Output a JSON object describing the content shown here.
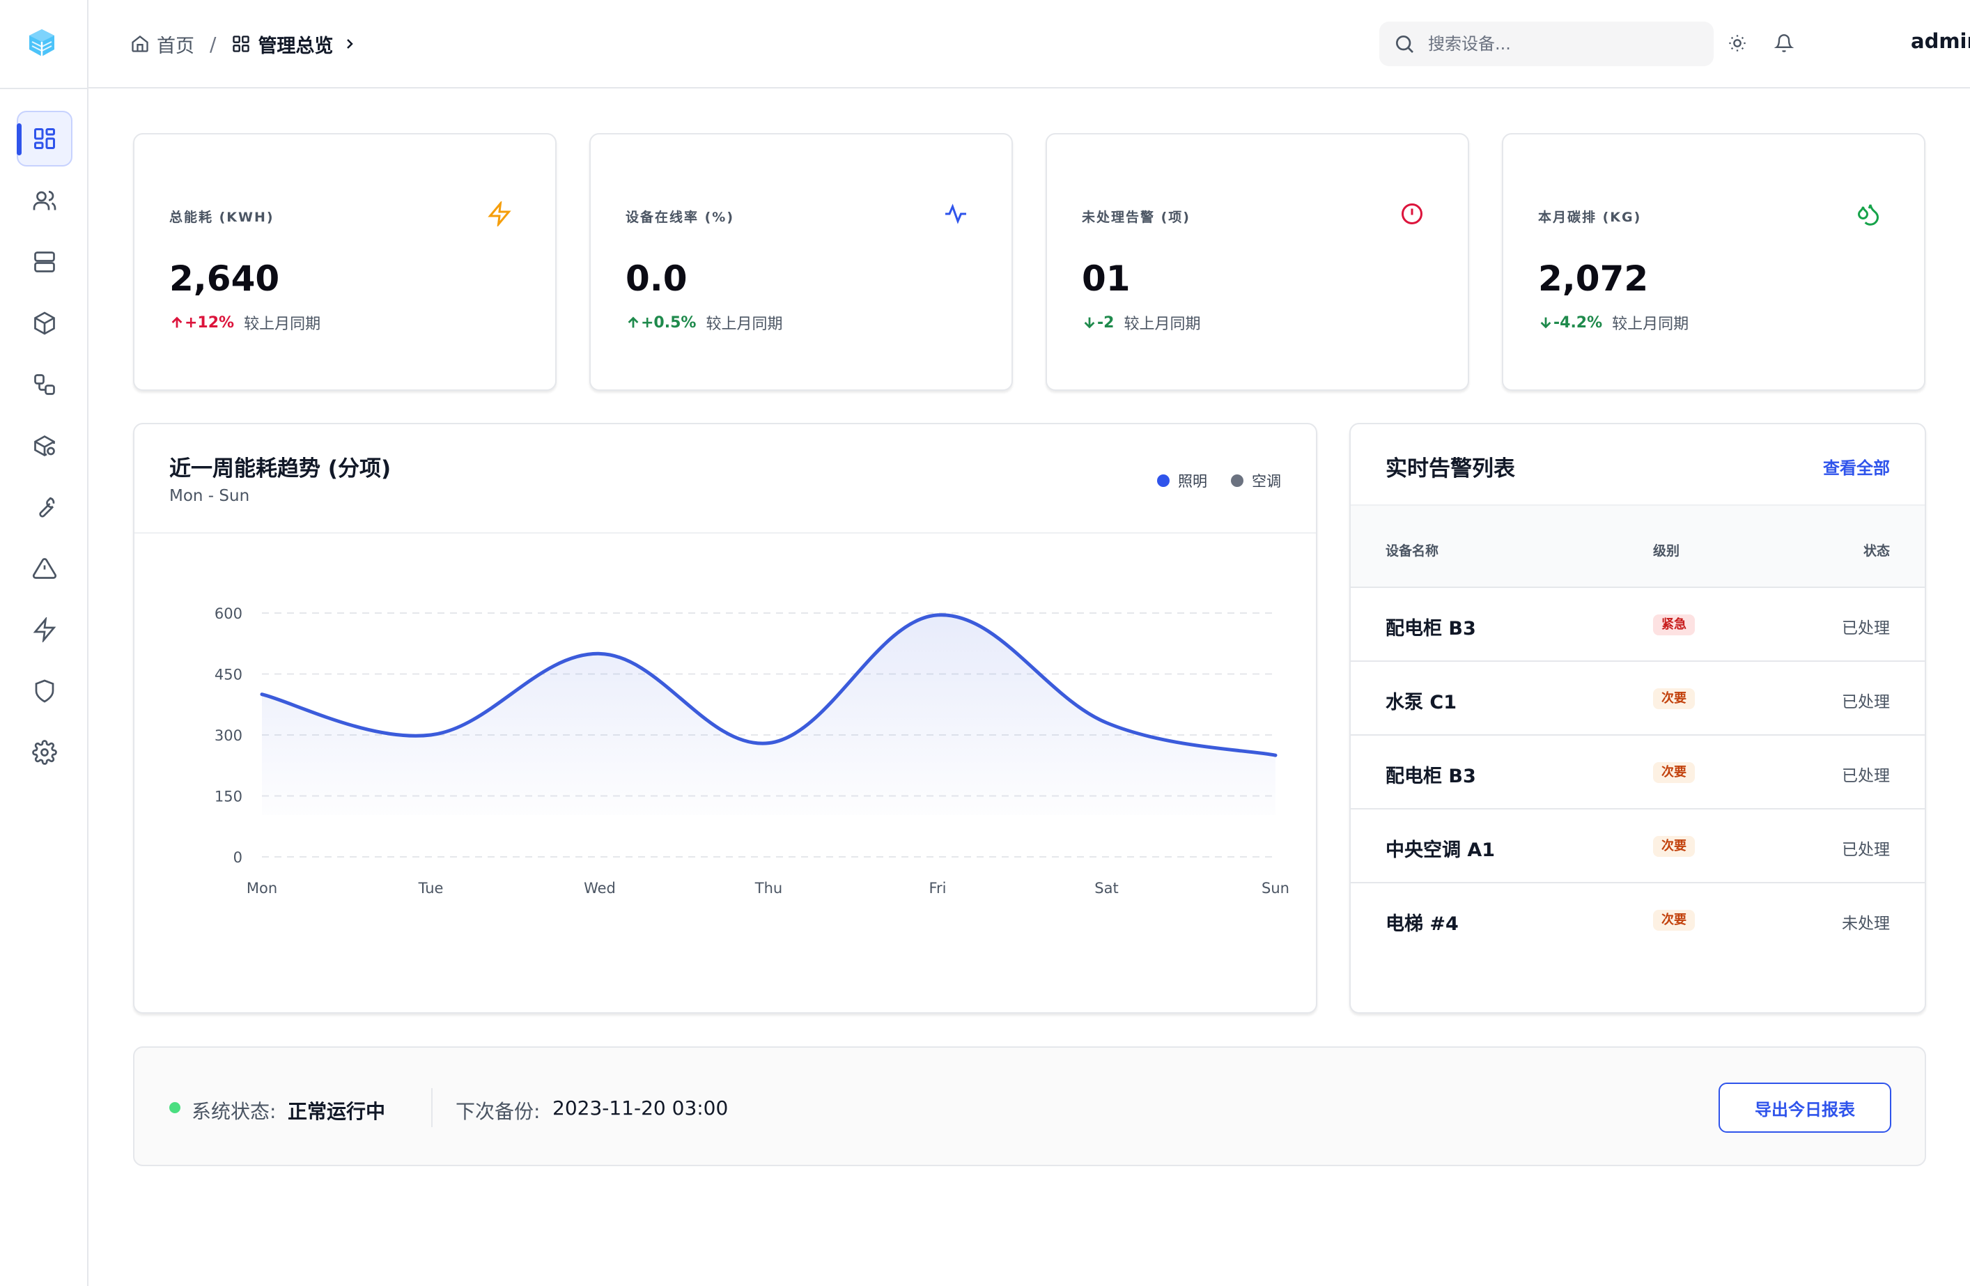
{
  "breadcrumb": {
    "home": "首页",
    "separator": "/",
    "current": "管理总览"
  },
  "search": {
    "placeholder": "搜索设备..."
  },
  "header": {
    "user": "admin"
  },
  "sidebar": {
    "items": [
      {
        "icon": "dashboard-icon",
        "active": true
      },
      {
        "icon": "users-icon"
      },
      {
        "icon": "server-icon"
      },
      {
        "icon": "box-icon"
      },
      {
        "icon": "workflow-icon"
      },
      {
        "icon": "package-settings-icon"
      },
      {
        "icon": "wrench-icon"
      },
      {
        "icon": "warning-icon"
      },
      {
        "icon": "lightning-icon"
      },
      {
        "icon": "shield-icon"
      },
      {
        "icon": "gear-icon"
      }
    ]
  },
  "kpis": [
    {
      "label": "总能耗 (KWH)",
      "value": "2,640",
      "delta": "+12%",
      "note": "较上月同期",
      "icon": "lightning-icon",
      "color": "#f59e0b",
      "delta_color": "#dc143c",
      "direction": "up"
    },
    {
      "label": "设备在线率 (%)",
      "value": "0.0",
      "delta": "+0.5%",
      "note": "较上月同期",
      "icon": "pulse-icon",
      "color": "#2f54eb",
      "delta_color": "#1f8a4c",
      "direction": "up"
    },
    {
      "label": "未处理告警 (项)",
      "value": "01",
      "delta": "-2",
      "note": "较上月同期",
      "icon": "alert-circle-icon",
      "color": "#dc143c",
      "delta_color": "#1f8a4c",
      "direction": "down"
    },
    {
      "label": "本月碳排 (KG)",
      "value": "2,072",
      "delta": "-4.2%",
      "note": "较上月同期",
      "icon": "droplets-icon",
      "color": "#16a34a",
      "delta_color": "#1f8a4c",
      "direction": "down"
    }
  ],
  "chart": {
    "title": "近一周能耗趋势 (分项)",
    "subtitle": "Mon - Sun",
    "legend": [
      {
        "name": "照明",
        "color": "#2f54eb"
      },
      {
        "name": "空调",
        "color": "#6b7280"
      }
    ]
  },
  "chart_data": {
    "type": "area",
    "title": "近一周能耗趋势 (分项)",
    "categories": [
      "Mon",
      "Tue",
      "Wed",
      "Thu",
      "Fri",
      "Sat",
      "Sun"
    ],
    "series": [
      {
        "name": "照明",
        "values": [
          400,
          300,
          500,
          280,
          595,
          330,
          250
        ],
        "color": "#3b5bdb"
      }
    ],
    "yticks": [
      0,
      150,
      300,
      450,
      600
    ],
    "ylim": [
      0,
      600
    ],
    "grid": true,
    "legend_position": "top-right"
  },
  "alerts": {
    "title": "实时告警列表",
    "view_all": "查看全部",
    "columns": {
      "name": "设备名称",
      "level": "级别",
      "status": "状态"
    },
    "rows": [
      {
        "name": "配电柜 B3",
        "level": "紧急",
        "status": "已处理",
        "urgent": true
      },
      {
        "name": "水泵 C1",
        "level": "次要",
        "status": "已处理"
      },
      {
        "name": "配电柜 B3",
        "level": "次要",
        "status": "已处理"
      },
      {
        "name": "中央空调 A1",
        "level": "次要",
        "status": "已处理"
      },
      {
        "name": "电梯 #4",
        "level": "次要",
        "status": "未处理"
      }
    ]
  },
  "footer": {
    "status_label": "系统状态:",
    "status_value": "正常运行中",
    "backup_label": "下次备份:",
    "backup_value": "2023-11-20 03:00",
    "export_button": "导出今日报表"
  }
}
